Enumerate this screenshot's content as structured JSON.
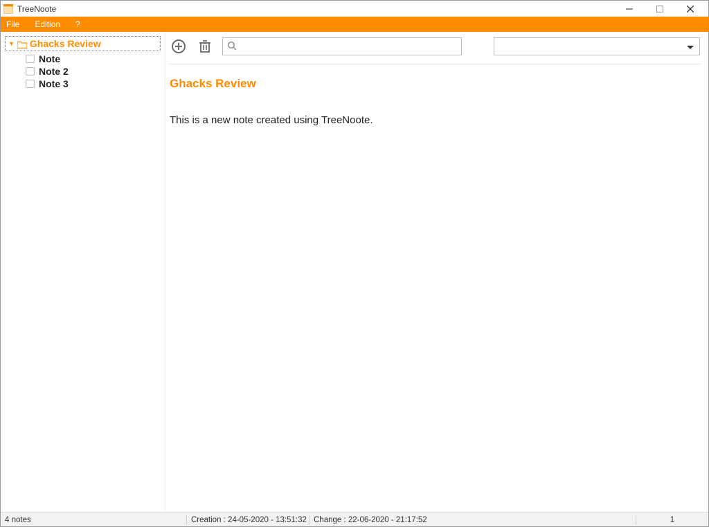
{
  "window": {
    "title": "TreeNoote"
  },
  "menu": {
    "file": "File",
    "edition": "Edition",
    "help": "?"
  },
  "tree": {
    "root": {
      "label": "Ghacks Review"
    },
    "children": [
      {
        "label": "Note"
      },
      {
        "label": "Note 2"
      },
      {
        "label": "Note 3"
      }
    ]
  },
  "toolbar": {
    "search_placeholder": "",
    "dropdown_value": ""
  },
  "note": {
    "title": "Ghacks Review",
    "body": "This is a new note created using TreeNoote."
  },
  "status": {
    "notes": "4  notes",
    "creation": "Creation : 24-05-2020 - 13:51:32",
    "change": "Change : 22-06-2020 - 21:17:52",
    "number": "1"
  },
  "colors": {
    "accent": "#FF8C00"
  }
}
